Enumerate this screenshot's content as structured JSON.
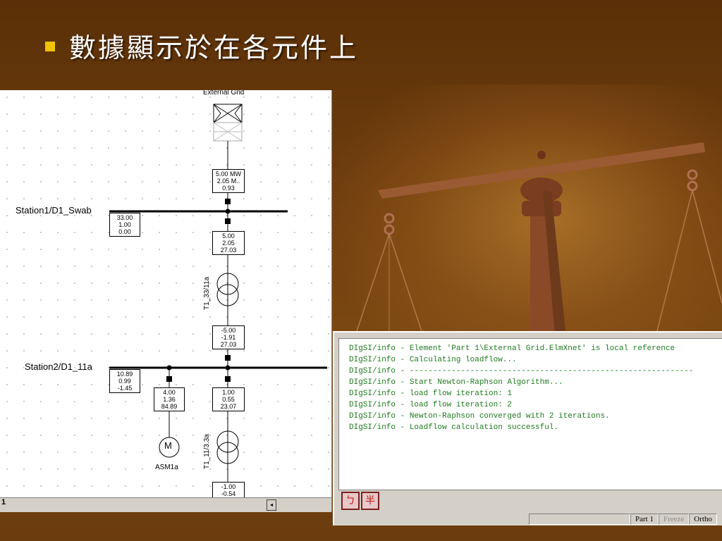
{
  "slide": {
    "title": "數據顯示於在各元件上",
    "colors": {
      "background": "#6b3b0c",
      "bullet": "#f2c200",
      "title_text": "#ffffff"
    }
  },
  "diagram": {
    "external_grid_label": "External Grid",
    "bus1_label": "Station1/D1_Swab",
    "bus2_label": "Station2/D1_11a",
    "transformer1_label": "T1_33/11a",
    "transformer2_label": "T1_11/3.3a",
    "motor_symbol": "M",
    "motor_label": "ASM1a",
    "grid_values": [
      "5.00 MW",
      "2.05 M..",
      "0.93"
    ],
    "bus1_values": [
      "33.00",
      "1.00",
      "0.00"
    ],
    "t1_hv_values": [
      "5.00",
      "2.05",
      "27.03"
    ],
    "t1_lv_values": [
      "-5.00",
      "-1.91",
      "27.03"
    ],
    "bus2_values": [
      "10.89",
      "0.99",
      "-1.45"
    ],
    "motor_values": [
      "4.00",
      "1.36",
      "84.89"
    ],
    "t2_hv_values": [
      "1.00",
      "0.55",
      "23.07"
    ],
    "t2_lv_values": [
      "-1.00",
      "-0.54"
    ],
    "page_tab": "1"
  },
  "output": {
    "lines": [
      "DIgSI/info - Element 'Part 1\\External Grid.ElmXnet' is local reference",
      "DIgSI/info - Calculating loadflow...",
      "DIgSI/info - -------------------------------------------------------------",
      "DIgSI/info - Start Newton-Raphson Algorithm...",
      "DIgSI/info - load flow iteration: 1",
      "DIgSI/info - load flow iteration: 2",
      "DIgSI/info - Newton-Raphson converged with 2 iterations.",
      "DIgSI/info - Loadflow calculation successful."
    ],
    "ime_buttons": [
      "ㄅ",
      "半"
    ],
    "status": {
      "part": "Part 1",
      "freeze": "Freeze",
      "ortho": "Ortho"
    }
  }
}
